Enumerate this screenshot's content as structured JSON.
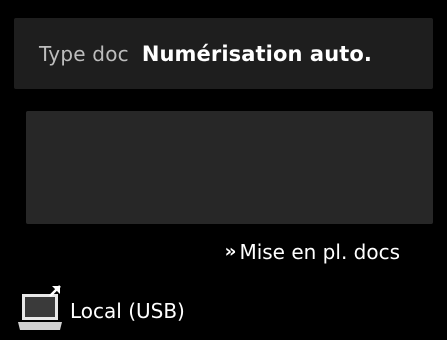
{
  "doc_type": {
    "label": "Type doc",
    "value": "Numérisation auto."
  },
  "load_documents": {
    "label": "Mise en pl. docs",
    "icon": "double-chevron-right-icon"
  },
  "destination": {
    "label": "Local (USB)",
    "icon": "computer-icon"
  },
  "colors": {
    "background": "#000000",
    "row_background": "#1e1e1e",
    "preview_background": "#272727",
    "label_gray": "#bdbdbd",
    "text_white": "#ffffff"
  }
}
